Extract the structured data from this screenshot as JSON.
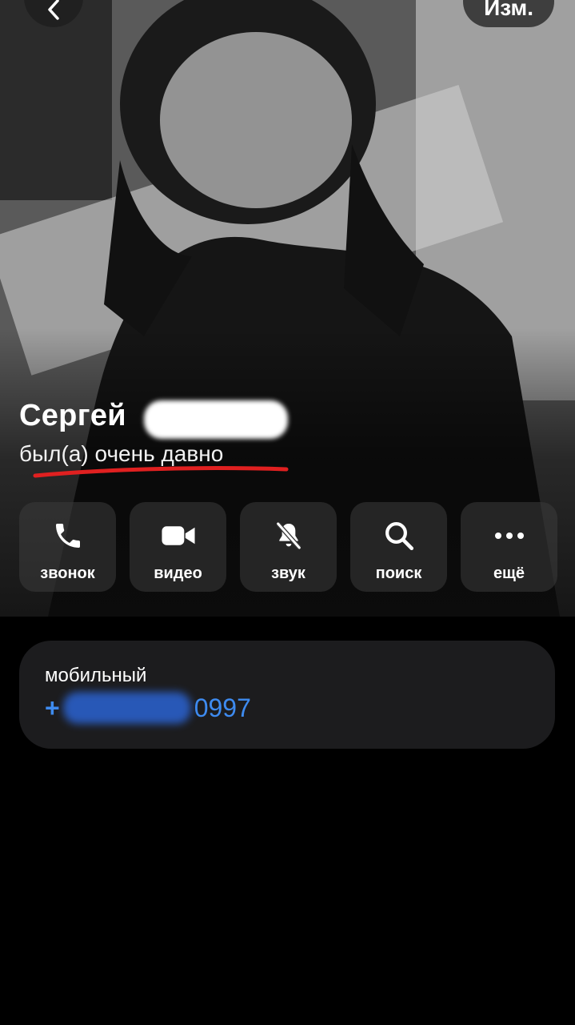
{
  "header": {
    "back_icon": "chevron-left-icon",
    "edit_label": "Изм."
  },
  "contact": {
    "name": "Сергей",
    "status": "был(а) очень давно",
    "underline_color": "#e02020"
  },
  "actions": [
    {
      "label": "звонок",
      "icon": "phone-icon"
    },
    {
      "label": "видео",
      "icon": "video-camera-icon"
    },
    {
      "label": "звук",
      "icon": "bell-slash-icon"
    },
    {
      "label": "поиск",
      "icon": "search-icon"
    },
    {
      "label": "ещё",
      "icon": "more-dots-icon"
    }
  ],
  "info": {
    "phone_type": "мобильный",
    "phone_prefix": "+",
    "phone_suffix": "0997",
    "link_color": "#3e8bf0"
  }
}
